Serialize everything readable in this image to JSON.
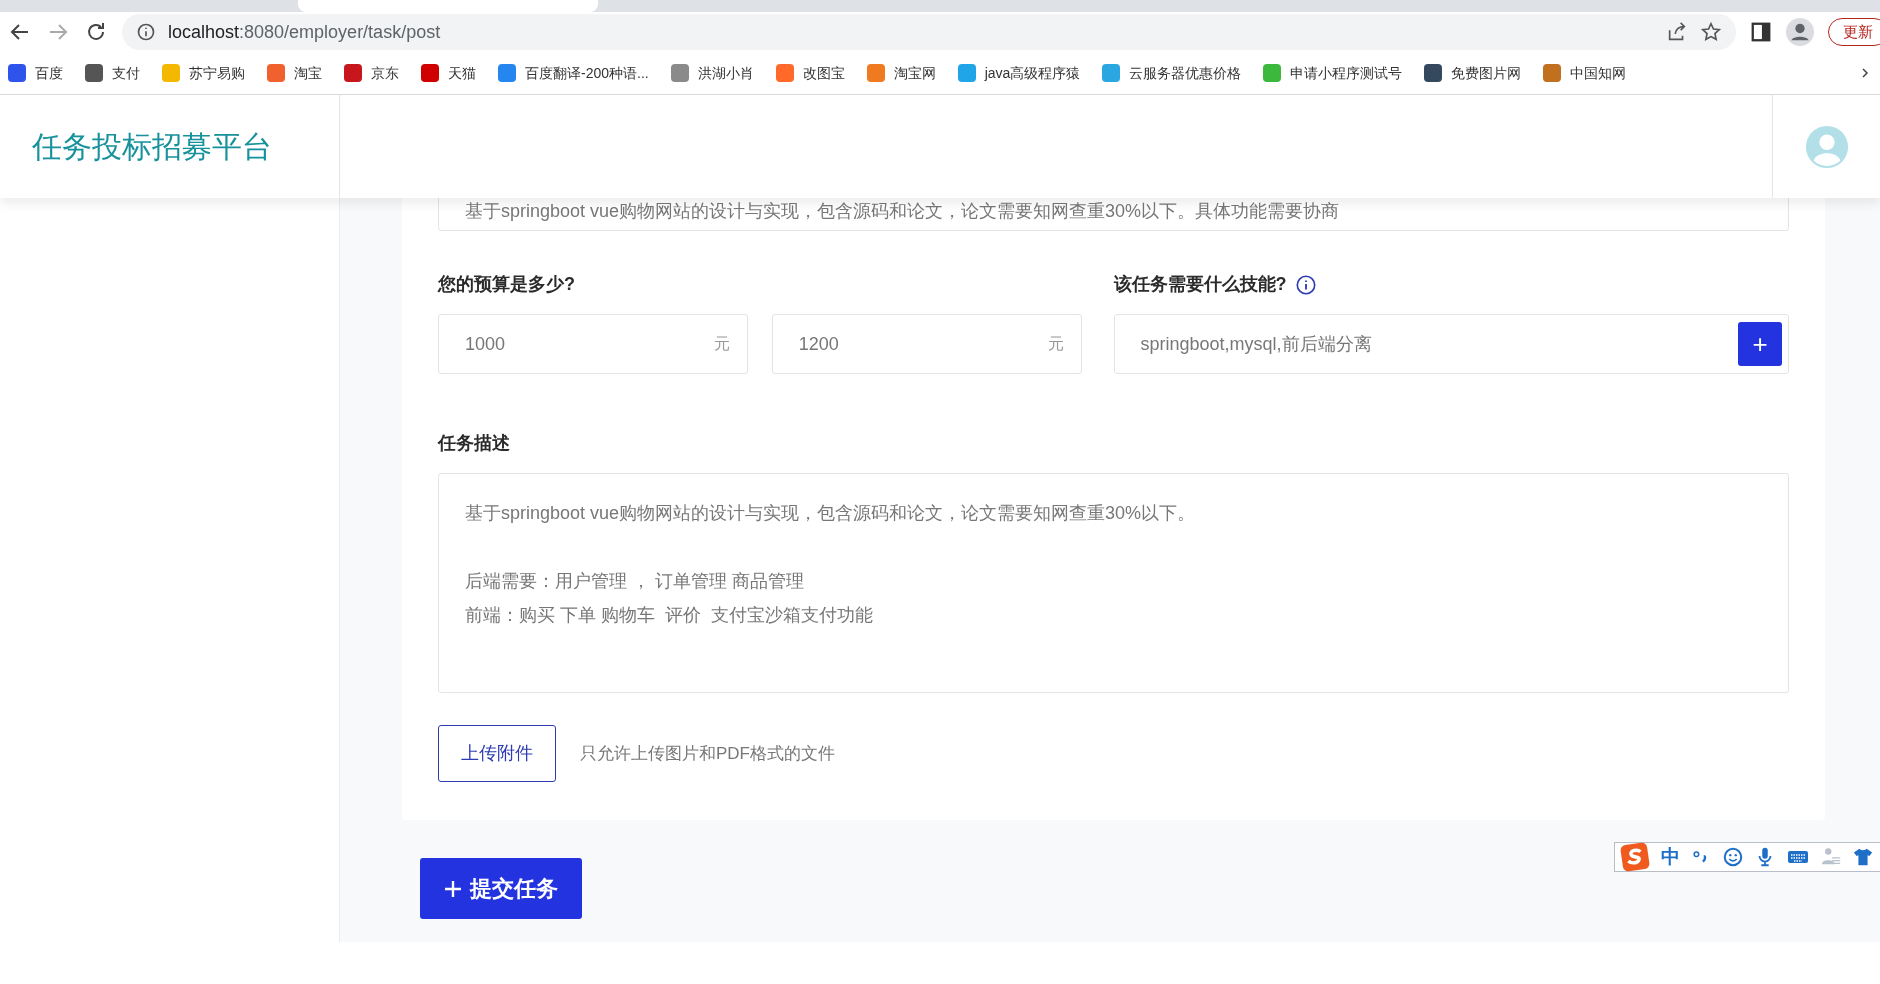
{
  "browser": {
    "url_host": "localhost",
    "url_path": ":8080/employer/task/post",
    "update_button": "更新",
    "bookmarks": [
      {
        "label": "百度",
        "color": "#2f54eb"
      },
      {
        "label": "支付",
        "color": "#555555"
      },
      {
        "label": "苏宁易购",
        "color": "#f5b800"
      },
      {
        "label": "淘宝",
        "color": "#f0612e"
      },
      {
        "label": "京东",
        "color": "#c8161d"
      },
      {
        "label": "天猫",
        "color": "#d00000"
      },
      {
        "label": "百度翻译-200种语...",
        "color": "#2586f0"
      },
      {
        "label": "洪湖小肖",
        "color": "#8a8a8a"
      },
      {
        "label": "改图宝",
        "color": "#ff6a2b"
      },
      {
        "label": "淘宝网",
        "color": "#f07a20"
      },
      {
        "label": "java高级程序猿",
        "color": "#20a6e8"
      },
      {
        "label": "云服务器优惠价格",
        "color": "#2aa7e0"
      },
      {
        "label": "申请小程序测试号",
        "color": "#3cb93c"
      },
      {
        "label": "免费图片网",
        "color": "#34495e"
      },
      {
        "label": "中国知网",
        "color": "#c0701e"
      }
    ]
  },
  "app": {
    "logo": "任务投标招募平台"
  },
  "form": {
    "summary_value": "基于springboot vue购物网站的设计与实现，包含源码和论文，论文需要知网查重30%以下。具体功能需要协商",
    "budget_label": "您的预算是多少?",
    "budget_min": {
      "value": "1000",
      "unit": "元"
    },
    "budget_max": {
      "value": "1200",
      "unit": "元"
    },
    "skills_label": "该任务需要什么技能?",
    "skills_value": "springboot,mysql,前后端分离",
    "add_button": "+",
    "description_label": "任务描述",
    "description_paragraphs": [
      [
        "基于springboot vue购物网站的设计与实现，包含源码和论文，论文需要知网查重30%以下。"
      ],
      [
        "后端需要：用户管理 ， 订单管理 商品管理",
        "前端：购买 下单 购物车  评价  支付宝沙箱支付功能"
      ]
    ],
    "upload_button": "上传附件",
    "upload_hint": "只允许上传图片和PDF格式的文件",
    "submit_button": "提交任务"
  },
  "ime_toolbar": {
    "mode": "中"
  }
}
